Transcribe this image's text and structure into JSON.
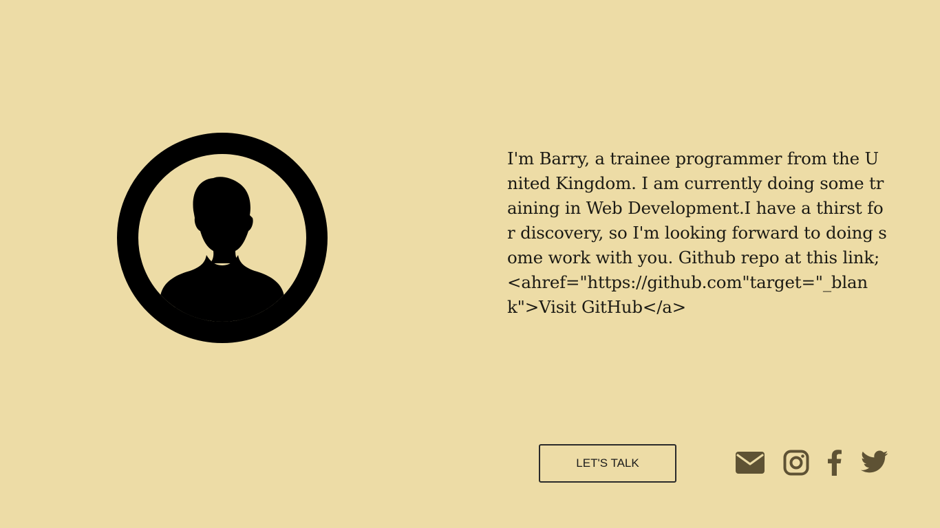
{
  "profile": {
    "avatar_icon": "user-silhouette-icon",
    "bio": "I'm Barry, a trainee programmer from the United Kingdom. I am currently doing some training in Web Development.I have a thirst for discovery, so I'm looking forward to doing some work with you. Github repo at this link; <ahref=\"https://github.com\"target=\"_blank\">Visit GitHub</a>"
  },
  "cta": {
    "label": "LET'S TALK"
  },
  "socials": [
    {
      "icon": "mail-icon"
    },
    {
      "icon": "instagram-icon"
    },
    {
      "icon": "facebook-icon"
    },
    {
      "icon": "twitter-icon"
    }
  ],
  "colors": {
    "background": "#eddca6",
    "text": "#1b1a14",
    "icon": "#5e5234"
  }
}
